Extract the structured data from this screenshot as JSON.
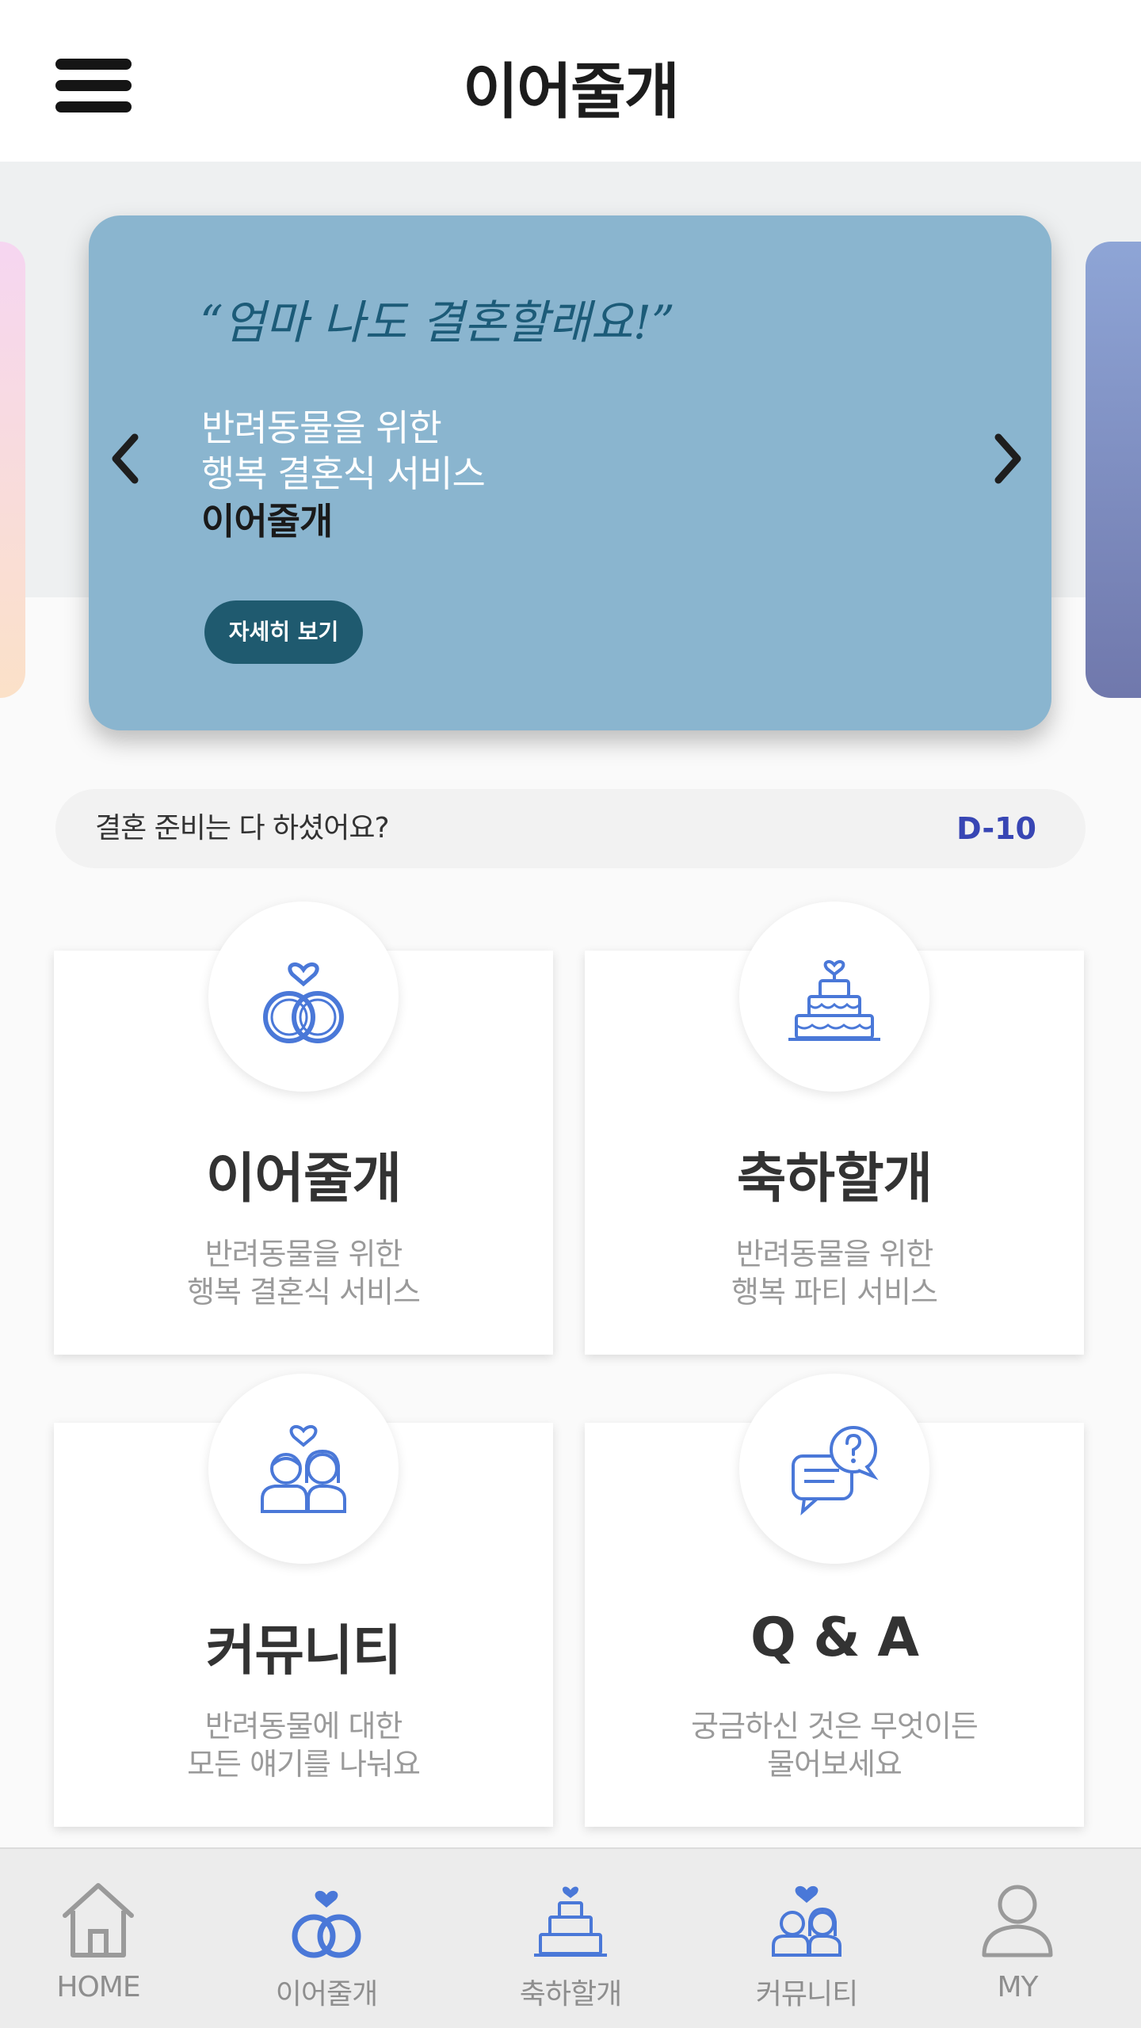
{
  "header": {
    "title": "이어줄개",
    "menu_icon": "hamburger-menu-icon"
  },
  "hero": {
    "quote": "“엄마 나도 결혼할래요!”",
    "line1": "반려동물을 위한",
    "line2": "행복 결혼식 서비스",
    "line3": "이어줄개",
    "button_label": "자세히 보기",
    "card_color": "#8ab5cf",
    "button_color": "#1f5a6f",
    "prev_icon": "chevron-left-icon",
    "next_icon": "chevron-right-icon"
  },
  "dday": {
    "question": "결혼 준비는 다 하셨어요?",
    "value": "D-10",
    "value_color": "#3846b4"
  },
  "services": [
    {
      "title": "이어줄개",
      "desc1": "반려동물을 위한",
      "desc2": "행복 결혼식 서비스",
      "icon": "wedding-rings-icon"
    },
    {
      "title": "축하할개",
      "desc1": "반려동물을 위한",
      "desc2": "행복 파티 서비스",
      "icon": "wedding-cake-icon"
    },
    {
      "title": "커뮤니티",
      "desc1": "반려동물에 대한",
      "desc2": "모든 얘기를 나눠요",
      "icon": "couple-icon"
    },
    {
      "title": "Q & A",
      "desc1": "궁금하신 것은 무엇이든",
      "desc2": "물어보세요",
      "icon": "question-chat-icon"
    }
  ],
  "accent_color": "#4a78d8",
  "bottom_nav": [
    {
      "label": "HOME",
      "icon": "home-icon"
    },
    {
      "label": "이어줄개",
      "icon": "wedding-rings-icon"
    },
    {
      "label": "축하할개",
      "icon": "wedding-cake-icon"
    },
    {
      "label": "커뮤니티",
      "icon": "couple-icon"
    },
    {
      "label": "MY",
      "icon": "user-icon"
    }
  ]
}
